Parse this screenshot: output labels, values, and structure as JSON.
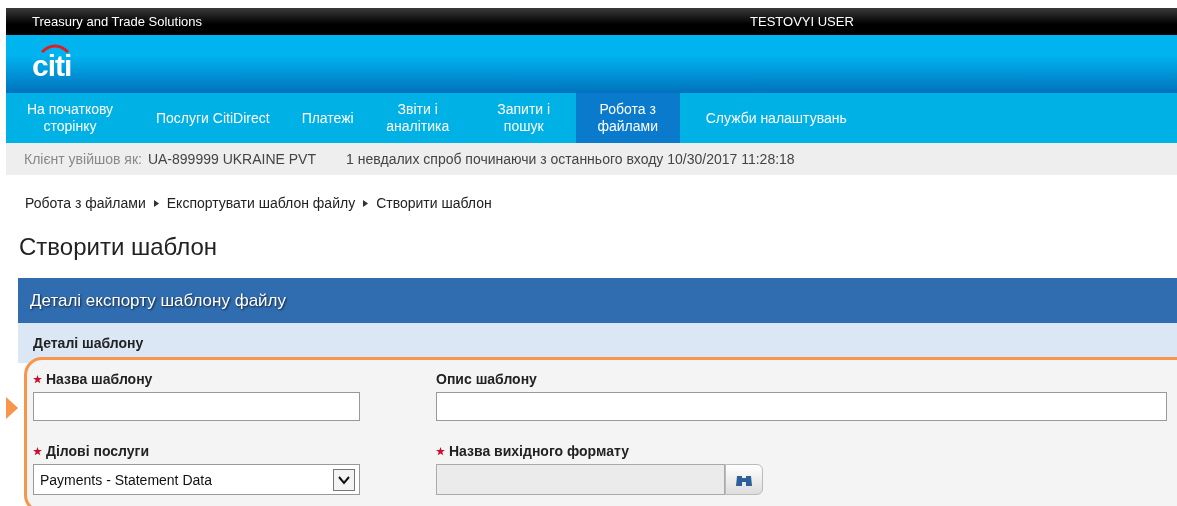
{
  "topbar": {
    "product": "Treasury and Trade Solutions",
    "user": "TESTOVYI USER"
  },
  "logo": "citi",
  "nav": [
    {
      "label": "На початкову сторінку",
      "selected": false
    },
    {
      "label": "Послуги CitiDirect",
      "selected": false
    },
    {
      "label": "Платежі",
      "selected": false
    },
    {
      "label": "Звіти і аналітика",
      "selected": false
    },
    {
      "label": "Запити і пошук",
      "selected": false
    },
    {
      "label": "Робота з файлами",
      "selected": true
    },
    {
      "label": "Служби налаштувань",
      "selected": false
    }
  ],
  "info_bar": {
    "client_label": "Клієнт увійшов як:",
    "client": "UA-899999 UKRAINE PVT",
    "login_note": "1 невдалих спроб починаючи з останнього входу 10/30/2017 11:28:18"
  },
  "breadcrumbs": [
    "Робота з файлами",
    "Експортувати шаблон файлу",
    "Створити шаблон"
  ],
  "page_title": "Створити шаблон",
  "panel": {
    "title": "Деталі експорту шаблону файлу",
    "section": "Деталі шаблону",
    "fields": [
      {
        "label": "Назва шаблону",
        "required": true,
        "kind": "text"
      },
      {
        "label": "Опис шаблону",
        "required": false,
        "kind": "text"
      },
      {
        "label": "Ділові послуги",
        "required": true,
        "kind": "select",
        "value": "Payments - Statement Data"
      },
      {
        "label": "Назва вихідного формату",
        "required": true,
        "kind": "lookup"
      }
    ]
  }
}
